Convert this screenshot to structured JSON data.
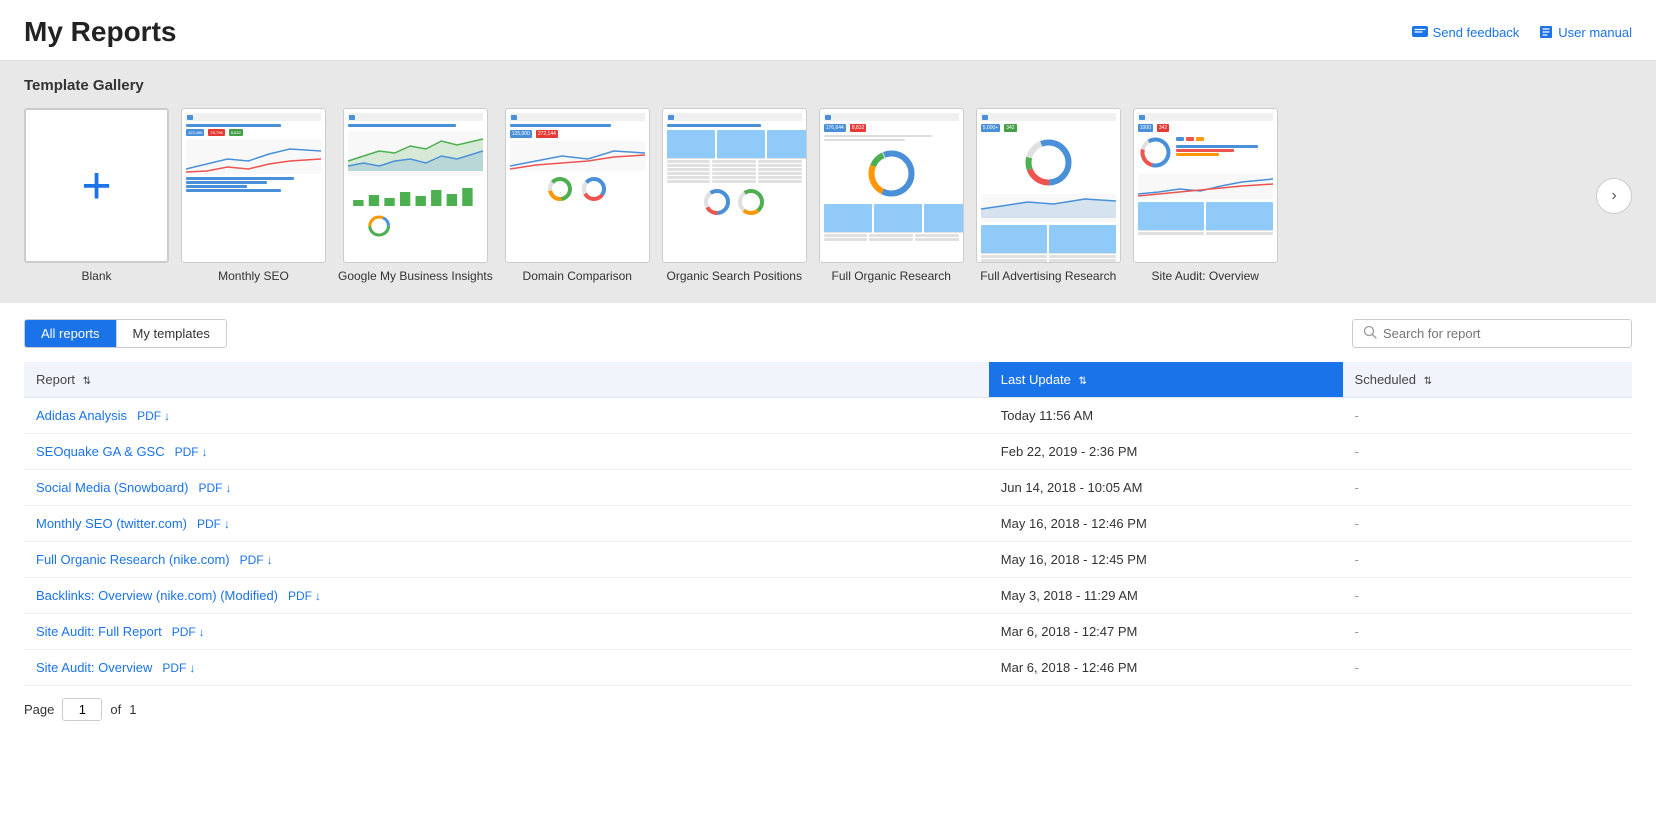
{
  "header": {
    "title": "My Reports",
    "send_feedback_label": "Send feedback",
    "user_manual_label": "User manual"
  },
  "gallery": {
    "title": "Template Gallery",
    "next_button_label": "›",
    "templates": [
      {
        "id": "blank",
        "label": "Blank",
        "type": "blank"
      },
      {
        "id": "monthly-seo",
        "label": "Monthly SEO",
        "type": "chart"
      },
      {
        "id": "google-my-business",
        "label": "Google My Business Insights",
        "type": "line-chart"
      },
      {
        "id": "domain-comparison",
        "label": "Domain Comparison",
        "type": "donut"
      },
      {
        "id": "organic-search-positions",
        "label": "Organic Search Positions",
        "type": "table"
      },
      {
        "id": "full-organic-research",
        "label": "Full Organic Research",
        "type": "donut2"
      },
      {
        "id": "full-advertising-research",
        "label": "Full Advertising Research",
        "type": "donut3"
      },
      {
        "id": "site-audit-overview",
        "label": "Site Audit: Overview",
        "type": "mixed"
      }
    ]
  },
  "tabs": {
    "all_reports_label": "All reports",
    "my_templates_label": "My templates"
  },
  "search": {
    "placeholder": "Search for report"
  },
  "table": {
    "col_report": "Report",
    "col_last_update": "Last Update",
    "col_scheduled": "Scheduled",
    "rows": [
      {
        "name": "Adidas Analysis",
        "pdf_label": "PDF",
        "last_update": "Today 11:56 AM",
        "scheduled": "-"
      },
      {
        "name": "SEOquake GA & GSC",
        "pdf_label": "PDF",
        "last_update": "Feb 22, 2019 - 2:36 PM",
        "scheduled": "-"
      },
      {
        "name": "Social Media (Snowboard)",
        "pdf_label": "PDF",
        "last_update": "Jun 14, 2018 - 10:05 AM",
        "scheduled": "-"
      },
      {
        "name": "Monthly SEO (twitter.com)",
        "pdf_label": "PDF",
        "last_update": "May 16, 2018 - 12:46 PM",
        "scheduled": "-"
      },
      {
        "name": "Full Organic Research (nike.com)",
        "pdf_label": "PDF",
        "last_update": "May 16, 2018 - 12:45 PM",
        "scheduled": "-"
      },
      {
        "name": "Backlinks: Overview (nike.com) (Modified)",
        "pdf_label": "PDF",
        "last_update": "May 3, 2018 - 11:29 AM",
        "scheduled": "-"
      },
      {
        "name": "Site Audit: Full Report",
        "pdf_label": "PDF",
        "last_update": "Mar 6, 2018 - 12:47 PM",
        "scheduled": "-"
      },
      {
        "name": "Site Audit: Overview",
        "pdf_label": "PDF",
        "last_update": "Mar 6, 2018 - 12:46 PM",
        "scheduled": "-"
      }
    ]
  },
  "pagination": {
    "page_label": "Page",
    "of_label": "of",
    "total_pages": "1",
    "current_page": "1"
  }
}
